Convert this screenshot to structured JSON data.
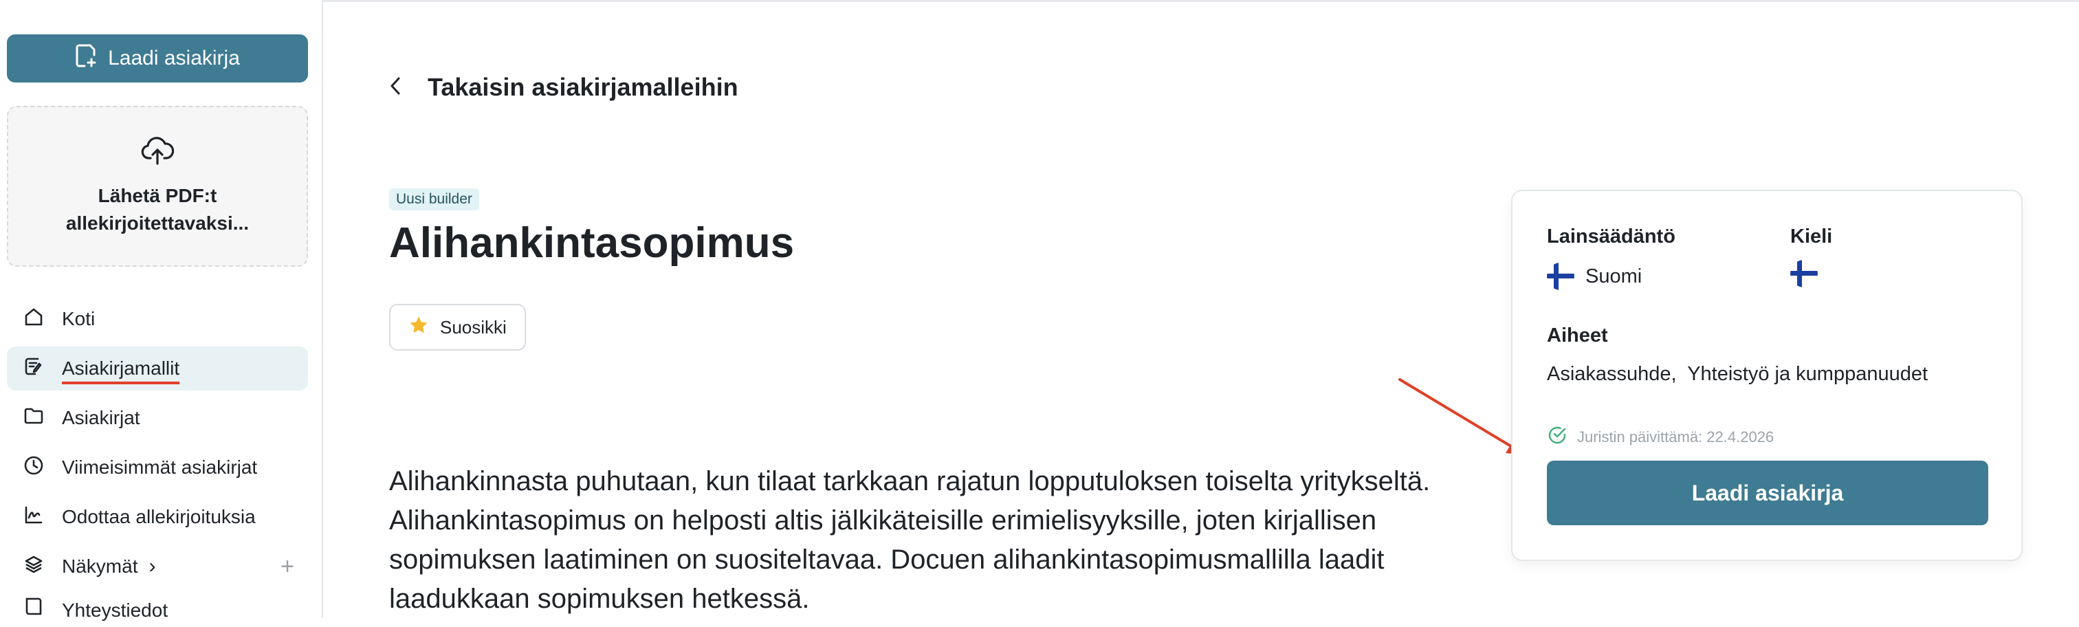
{
  "sidebar": {
    "create_button": "Laadi asiakirja",
    "upload_text": "Lähetä PDF:t allekirjoitettavaksi...",
    "items": [
      {
        "label": "Koti",
        "icon": "home-icon"
      },
      {
        "label": "Asiakirjamallit",
        "icon": "template-icon"
      },
      {
        "label": "Asiakirjat",
        "icon": "folder-icon"
      },
      {
        "label": "Viimeisimmät asiakirjat",
        "icon": "clock-icon"
      },
      {
        "label": "Odottaa allekirjoituksia",
        "icon": "signature-icon"
      },
      {
        "label": "Näkymät",
        "icon": "layers-icon",
        "chevron": "›",
        "plus": "+"
      },
      {
        "label": "Yhteystiedot",
        "icon": "book-icon"
      }
    ]
  },
  "main": {
    "back_label": "Takaisin asiakirjamalleihin",
    "badge": "Uusi builder",
    "title": "Alihankintasopimus",
    "favorite_label": "Suosikki",
    "description": "Alihankinnasta puhutaan, kun tilaat tarkkaan rajatun lopputuloksen toiselta yritykseltä. Alihankintasopimus on helposti altis jälkikäteisille erimielisyyksille, joten kirjallisen sopimuksen laatiminen on suositeltavaa. Docuen alihankintasopimusmallilla laadit laadukkaan sopimuksen hetkessä."
  },
  "info_card": {
    "jurisdiction_heading": "Lainsäädäntö",
    "jurisdiction_value": "Suomi",
    "language_heading": "Kieli",
    "topics_heading": "Aiheet",
    "topics_value": "Asiakassuhde,  Yhteistyö ja kumppanuudet",
    "updated_text": "Juristin päivittämä: 22.4.2026",
    "cta_label": "Laadi asiakirja"
  },
  "colors": {
    "primary": "#3f7b92",
    "active_nav_bg": "#e8f2f5",
    "annotation_red": "#e0412a",
    "flag_blue": "#1b3fa0"
  }
}
